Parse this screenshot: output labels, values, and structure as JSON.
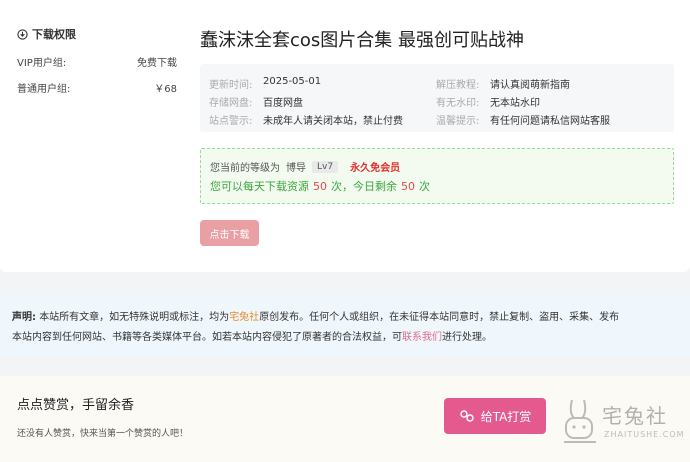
{
  "sidebar": {
    "heading": "下载权限",
    "rows": [
      {
        "label": "VIP用户组:",
        "value": "免费下载"
      },
      {
        "label": "普通用户组:",
        "value": "￥68"
      }
    ]
  },
  "post": {
    "title": "蠢沫沫全套cos图片合集 最强创可贴战神"
  },
  "info": {
    "update_time": {
      "key": "更新时间:",
      "value": "2025-05-01"
    },
    "storage": {
      "key": "存储网盘:",
      "value": "百度网盘"
    },
    "warning": {
      "key": "站点警示:",
      "value": "未成年人请关闭本站，禁止付费"
    },
    "extract": {
      "key": "解压教程:",
      "value": "请认真阅萌新指南"
    },
    "watermark": {
      "key": "有无水印:",
      "value": "无本站水印"
    },
    "tip": {
      "key": "温馨提示:",
      "value": "有任何问题请私信网站客服"
    }
  },
  "level": {
    "prefix": "您当前的等级为",
    "rank": "博导",
    "badge": "Lv7",
    "vip": "永久免会员",
    "line2_a": "您可以每天下载资源",
    "daily": "50",
    "line2_b": "次，今日剩余",
    "remaining": "50",
    "line2_c": "次"
  },
  "download_button": "点击下载",
  "notice": {
    "label": "声明:",
    "text1": "本站所有文章，如无特殊说明或标注，均为",
    "site_name": "宅兔社",
    "text2": "原创发布。任何个人或组织，在未征得本站同意时，禁止复制、盗用、采集、发布",
    "text3": "本站内容到任何网站、书籍等各类媒体平台。如若本站内容侵犯了原著者的合法权益，可",
    "contact": "联系我们",
    "text4": "进行处理。"
  },
  "reward": {
    "title": "点点赞赏，手留余香",
    "subtitle": "还没有人赞赏，快来当第一个赞赏的人吧！",
    "button": "给TA打赏"
  },
  "watermark_logo": {
    "text": "宅兔社",
    "url": "ZHAITUSHE.COM"
  }
}
